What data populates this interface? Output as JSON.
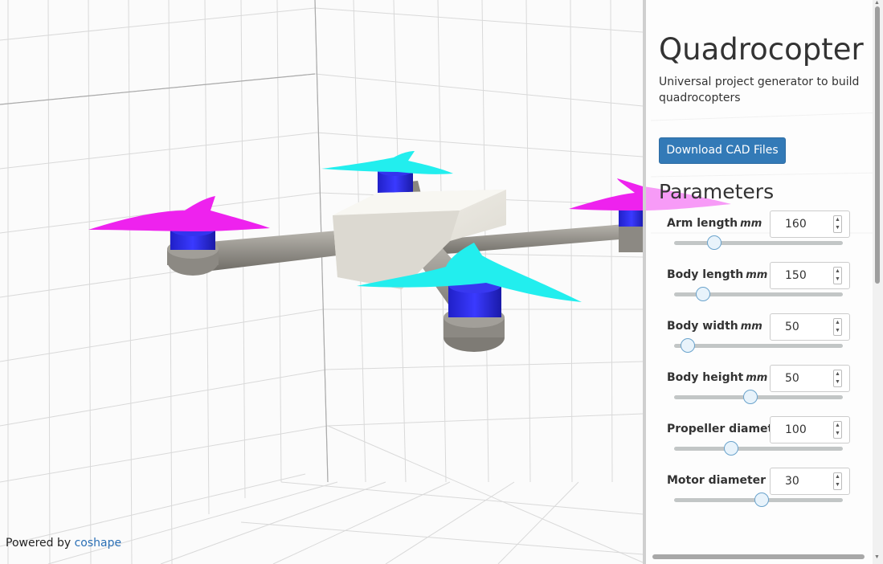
{
  "viewport": {
    "model_name": "quadrocopter-3d-model",
    "powered_prefix": "Powered by",
    "powered_link": "coshape",
    "colors": {
      "propeller_magenta": "#ee22ee",
      "propeller_cyan": "#22eeee",
      "motor_blue": "#2222dd",
      "frame_gray": "#8f8c86",
      "body_white": "#eeece6"
    }
  },
  "panel": {
    "title": "Quadrocopter",
    "subtitle": "Universal project generator to build quadrocopters",
    "download_label": "Download CAD Files",
    "parameters_title": "Parameters",
    "parameters": [
      {
        "label": "Arm length",
        "unit": "mm",
        "value": "160",
        "slider_fraction": 0.24
      },
      {
        "label": "Body length",
        "unit": "mm",
        "value": "150",
        "slider_fraction": 0.17
      },
      {
        "label": "Body width",
        "unit": "mm",
        "value": "50",
        "slider_fraction": 0.08
      },
      {
        "label": "Body height",
        "unit": "mm",
        "value": "50",
        "slider_fraction": 0.45
      },
      {
        "label": "Propeller diameter",
        "unit": "",
        "value": "100",
        "slider_fraction": 0.34
      },
      {
        "label": "Motor diameter",
        "unit": "",
        "value": "30",
        "slider_fraction": 0.52
      }
    ]
  }
}
